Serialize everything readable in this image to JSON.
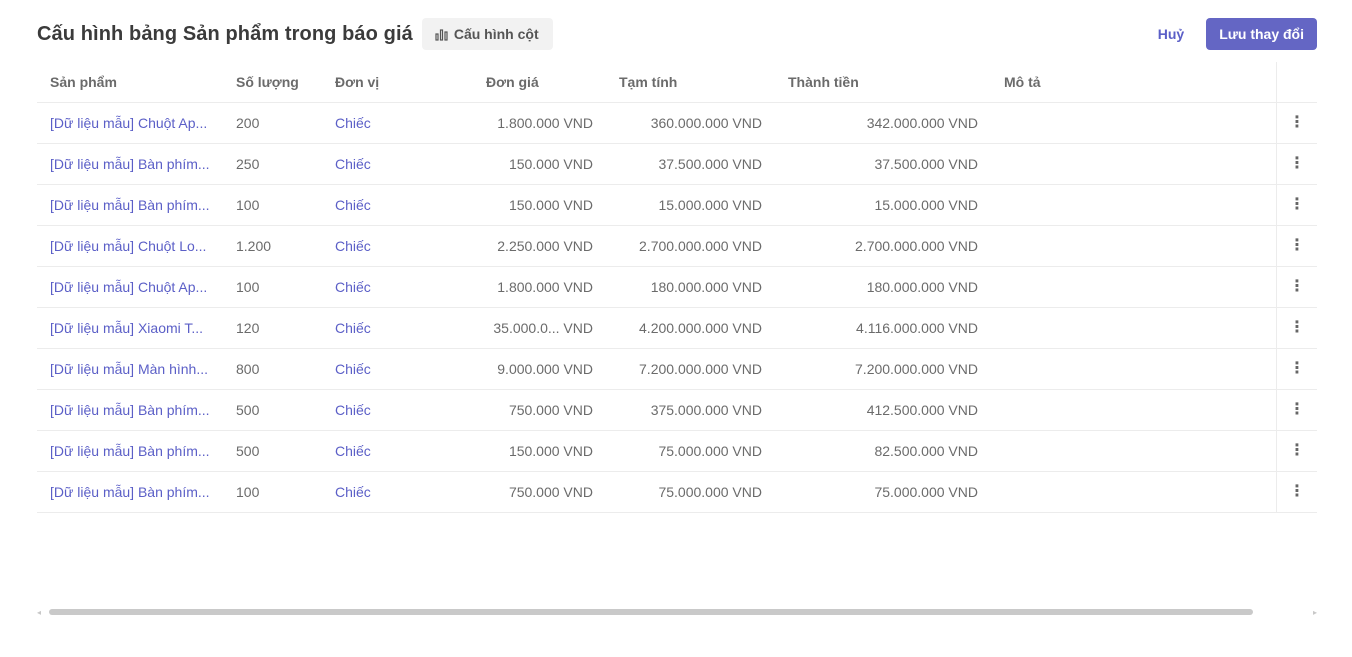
{
  "header": {
    "title": "Cấu hình bảng Sản phẩm trong báo giá",
    "config_button": "Cấu hình cột",
    "config_icon": "bar-chart-icon",
    "cancel_button": "Huỷ",
    "save_button": "Lưu thay đổi",
    "accent_color": "#6466c4"
  },
  "table": {
    "columns": {
      "product": "Sản phẩm",
      "quantity": "Số lượng",
      "unit": "Đơn vị",
      "unit_price": "Đơn giá",
      "subtotal": "Tạm tính",
      "total": "Thành tiền",
      "description": "Mô tả"
    },
    "rows": [
      {
        "product": "[Dữ liệu mẫu] Chuột Ap...",
        "quantity": "200",
        "unit": "Chiếc",
        "unit_price": "1.800.000 VND",
        "subtotal": "360.000.000 VND",
        "total": "342.000.000 VND",
        "description": ""
      },
      {
        "product": "[Dữ liệu mẫu] Bàn phím...",
        "quantity": "250",
        "unit": "Chiếc",
        "unit_price": "150.000 VND",
        "subtotal": "37.500.000 VND",
        "total": "37.500.000 VND",
        "description": ""
      },
      {
        "product": "[Dữ liệu mẫu] Bàn phím...",
        "quantity": "100",
        "unit": "Chiếc",
        "unit_price": "150.000 VND",
        "subtotal": "15.000.000 VND",
        "total": "15.000.000 VND",
        "description": ""
      },
      {
        "product": "[Dữ liệu mẫu] Chuột Lo...",
        "quantity": "1.200",
        "unit": "Chiếc",
        "unit_price": "2.250.000 VND",
        "subtotal": "2.700.000.000 VND",
        "total": "2.700.000.000 VND",
        "description": ""
      },
      {
        "product": "[Dữ liệu mẫu] Chuột Ap...",
        "quantity": "100",
        "unit": "Chiếc",
        "unit_price": "1.800.000 VND",
        "subtotal": "180.000.000 VND",
        "total": "180.000.000 VND",
        "description": ""
      },
      {
        "product": "[Dữ liệu mẫu] Xiaomi T...",
        "quantity": "120",
        "unit": "Chiếc",
        "unit_price": "35.000.0...   VND",
        "subtotal": "4.200.000.000 VND",
        "total": "4.116.000.000 VND",
        "description": ""
      },
      {
        "product": "[Dữ liệu mẫu] Màn hình...",
        "quantity": "800",
        "unit": "Chiếc",
        "unit_price": "9.000.000 VND",
        "subtotal": "7.200.000.000 VND",
        "total": "7.200.000.000 VND",
        "description": ""
      },
      {
        "product": "[Dữ liệu mẫu] Bàn phím...",
        "quantity": "500",
        "unit": "Chiếc",
        "unit_price": "750.000 VND",
        "subtotal": "375.000.000 VND",
        "total": "412.500.000 VND",
        "description": ""
      },
      {
        "product": "[Dữ liệu mẫu] Bàn phím...",
        "quantity": "500",
        "unit": "Chiếc",
        "unit_price": "150.000 VND",
        "subtotal": "75.000.000 VND",
        "total": "82.500.000 VND",
        "description": ""
      },
      {
        "product": "[Dữ liệu mẫu] Bàn phím...",
        "quantity": "100",
        "unit": "Chiếc",
        "unit_price": "750.000 VND",
        "subtotal": "75.000.000 VND",
        "total": "75.000.000 VND",
        "description": ""
      }
    ],
    "row_action_icon": "more-vertical-icon",
    "row_action_glyph": "⋮"
  },
  "scrollbar": {
    "left_arrow": "◂",
    "right_arrow": "▸"
  }
}
